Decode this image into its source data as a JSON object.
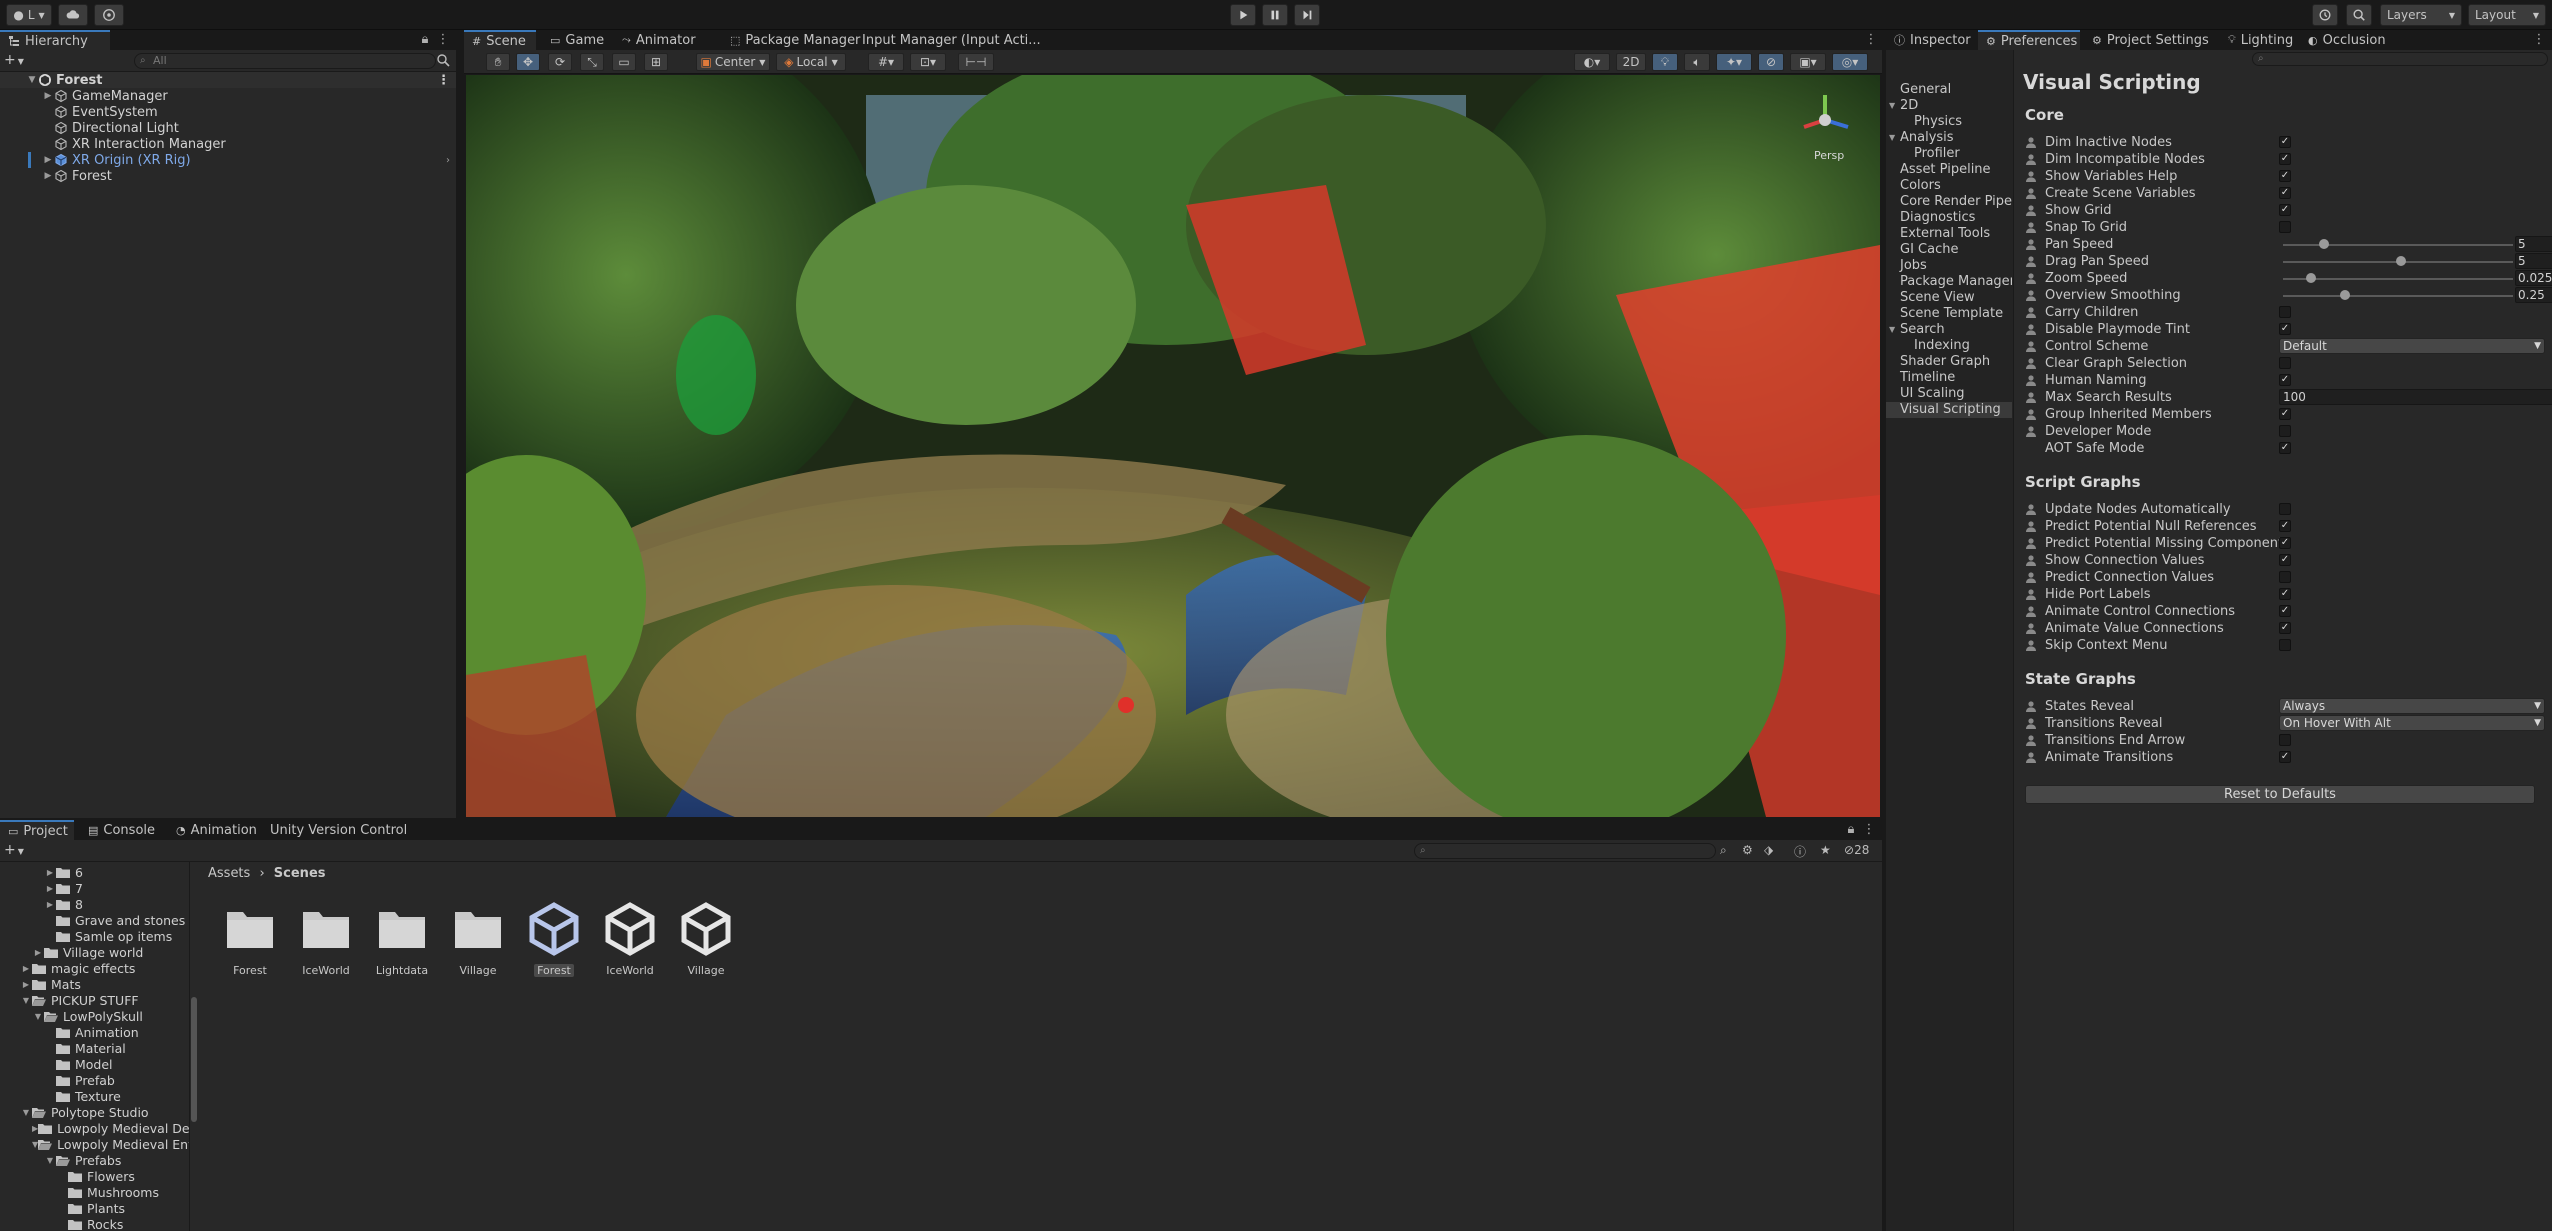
{
  "toolbar": {
    "account_label": "L",
    "layers_label": "Layers",
    "layout_label": "Layout"
  },
  "hierarchy": {
    "tab_label": "Hierarchy",
    "search_placeholder": "All",
    "scene_name": "Forest",
    "items": [
      {
        "label": "GameManager",
        "color": "#d2d2d2"
      },
      {
        "label": "EventSystem",
        "color": "#d2d2d2"
      },
      {
        "label": "Directional Light",
        "color": "#d2d2d2"
      },
      {
        "label": "XR Interaction Manager",
        "color": "#d2d2d2"
      },
      {
        "label": "XR Origin (XR Rig)",
        "color": "#7fa9e8"
      },
      {
        "label": "Forest",
        "color": "#d2d2d2"
      }
    ]
  },
  "scene": {
    "tabs": [
      "Scene",
      "Game",
      "Animator",
      "Package Manager",
      "Input Manager (Input Acti..."
    ],
    "pivot_label": "Center",
    "space_label": "Local",
    "mode_2d_label": "2D",
    "persp_label": "Persp"
  },
  "inspector": {
    "tabs": [
      "Inspector",
      "Preferences",
      "Project Settings",
      "Lighting",
      "Occlusion"
    ],
    "search_placeholder": "",
    "pref_items": [
      {
        "label": "General",
        "indent": 0
      },
      {
        "label": "2D",
        "indent": 0,
        "arrow": "▼"
      },
      {
        "label": "Physics",
        "indent": 1
      },
      {
        "label": "Analysis",
        "indent": 0,
        "arrow": "▼"
      },
      {
        "label": "Profiler",
        "indent": 1
      },
      {
        "label": "Asset Pipeline",
        "indent": 0
      },
      {
        "label": "Colors",
        "indent": 0
      },
      {
        "label": "Core Render Pipeline",
        "indent": 0
      },
      {
        "label": "Diagnostics",
        "indent": 0
      },
      {
        "label": "External Tools",
        "indent": 0
      },
      {
        "label": "GI Cache",
        "indent": 0
      },
      {
        "label": "Jobs",
        "indent": 0
      },
      {
        "label": "Package Manager",
        "indent": 0
      },
      {
        "label": "Scene View",
        "indent": 0
      },
      {
        "label": "Scene Template",
        "indent": 0
      },
      {
        "label": "Search",
        "indent": 0,
        "arrow": "▼"
      },
      {
        "label": "Indexing",
        "indent": 1
      },
      {
        "label": "Shader Graph",
        "indent": 0
      },
      {
        "label": "Timeline",
        "indent": 0
      },
      {
        "label": "UI Scaling",
        "indent": 0
      },
      {
        "label": "Visual Scripting",
        "indent": 0,
        "selected": true
      }
    ],
    "title": "Visual Scripting",
    "sections": [
      {
        "title": "Core",
        "rows": [
          {
            "label": "Dim Inactive Nodes",
            "type": "check",
            "checked": true
          },
          {
            "label": "Dim Incompatible Nodes",
            "type": "check",
            "checked": true
          },
          {
            "label": "Show Variables Help",
            "type": "check",
            "checked": true
          },
          {
            "label": "Create Scene Variables",
            "type": "check",
            "checked": true
          },
          {
            "label": "Show Grid",
            "type": "check",
            "checked": true
          },
          {
            "label": "Snap To Grid",
            "type": "check",
            "checked": false
          },
          {
            "label": "Pan Speed",
            "type": "slider",
            "value": "5",
            "fraction": 0.16
          },
          {
            "label": "Drag Pan Speed",
            "type": "slider",
            "value": "5",
            "fraction": 0.5
          },
          {
            "label": "Zoom Speed",
            "type": "slider",
            "value": "0.025",
            "fraction": 0.1
          },
          {
            "label": "Overview Smoothing",
            "type": "slider",
            "value": "0.25",
            "fraction": 0.25
          },
          {
            "label": "Carry Children",
            "type": "check",
            "checked": false
          },
          {
            "label": "Disable Playmode Tint",
            "type": "check",
            "checked": true
          },
          {
            "label": "Control Scheme",
            "type": "dropdown",
            "value": "Default"
          },
          {
            "label": "Clear Graph Selection",
            "type": "check",
            "checked": false
          },
          {
            "label": "Human Naming",
            "type": "check",
            "checked": true
          },
          {
            "label": "Max Search Results",
            "type": "text",
            "value": "100"
          },
          {
            "label": "Group Inherited Members",
            "type": "check",
            "checked": true
          },
          {
            "label": "Developer Mode",
            "type": "check",
            "checked": false
          },
          {
            "label": "AOT Safe Mode",
            "type": "check",
            "checked": true,
            "noicon": true
          }
        ]
      },
      {
        "title": "Script Graphs",
        "rows": [
          {
            "label": "Update Nodes Automatically",
            "type": "check",
            "checked": false
          },
          {
            "label": "Predict Potential Null References",
            "type": "check",
            "checked": true
          },
          {
            "label": "Predict Potential Missing Components",
            "type": "check",
            "checked": true
          },
          {
            "label": "Show Connection Values",
            "type": "check",
            "checked": true
          },
          {
            "label": "Predict Connection Values",
            "type": "check",
            "checked": false
          },
          {
            "label": "Hide Port Labels",
            "type": "check",
            "checked": true
          },
          {
            "label": "Animate Control Connections",
            "type": "check",
            "checked": true
          },
          {
            "label": "Animate Value Connections",
            "type": "check",
            "checked": true
          },
          {
            "label": "Skip Context Menu",
            "type": "check",
            "checked": false
          }
        ]
      },
      {
        "title": "State Graphs",
        "rows": [
          {
            "label": "States Reveal",
            "type": "dropdown",
            "value": "Always"
          },
          {
            "label": "Transitions Reveal",
            "type": "dropdown",
            "value": "On Hover With Alt"
          },
          {
            "label": "Transitions End Arrow",
            "type": "check",
            "checked": false
          },
          {
            "label": "Animate Transitions",
            "type": "check",
            "checked": true
          }
        ]
      }
    ],
    "reset_label": "Reset to Defaults"
  },
  "project": {
    "tabs": [
      "Project",
      "Console",
      "Animation",
      "Unity Version Control"
    ],
    "hidden_count": "28",
    "breadcrumb": [
      "Assets",
      "Scenes"
    ],
    "tree": [
      {
        "label": "6",
        "indent": 3,
        "arrow": "▶"
      },
      {
        "label": "7",
        "indent": 3,
        "arrow": "▶"
      },
      {
        "label": "8",
        "indent": 3,
        "arrow": "▶"
      },
      {
        "label": "Grave and stones",
        "indent": 3
      },
      {
        "label": "Samle op items",
        "indent": 3
      },
      {
        "label": "Village world",
        "indent": 2,
        "arrow": "▶"
      },
      {
        "label": "magic effects",
        "indent": 1,
        "arrow": "▶"
      },
      {
        "label": "Mats",
        "indent": 1,
        "arrow": "▶"
      },
      {
        "label": "PICKUP STUFF",
        "indent": 1,
        "arrow": "▼",
        "open": true
      },
      {
        "label": "LowPolySkull",
        "indent": 2,
        "arrow": "▼",
        "open": true
      },
      {
        "label": "Animation",
        "indent": 3
      },
      {
        "label": "Material",
        "indent": 3
      },
      {
        "label": "Model",
        "indent": 3
      },
      {
        "label": "Prefab",
        "indent": 3
      },
      {
        "label": "Texture",
        "indent": 3
      },
      {
        "label": "Polytope Studio",
        "indent": 1,
        "arrow": "▼",
        "open": true
      },
      {
        "label": "Lowpoly Medieval Dem",
        "indent": 2,
        "arrow": "▶"
      },
      {
        "label": "Lowpoly Medieval Envi",
        "indent": 2,
        "arrow": "▼",
        "open": true
      },
      {
        "label": "Prefabs",
        "indent": 3,
        "arrow": "▼",
        "open": true
      },
      {
        "label": "Flowers",
        "indent": 4
      },
      {
        "label": "Mushrooms",
        "indent": 4
      },
      {
        "label": "Plants",
        "indent": 4
      },
      {
        "label": "Rocks",
        "indent": 4
      }
    ],
    "assets": [
      {
        "label": "Forest",
        "kind": "folder"
      },
      {
        "label": "IceWorld",
        "kind": "folder"
      },
      {
        "label": "Lightdata",
        "kind": "folder"
      },
      {
        "label": "Village",
        "kind": "folder"
      },
      {
        "label": "Forest",
        "kind": "scene",
        "selected": true
      },
      {
        "label": "IceWorld",
        "kind": "scene"
      },
      {
        "label": "Village",
        "kind": "scene"
      }
    ]
  }
}
